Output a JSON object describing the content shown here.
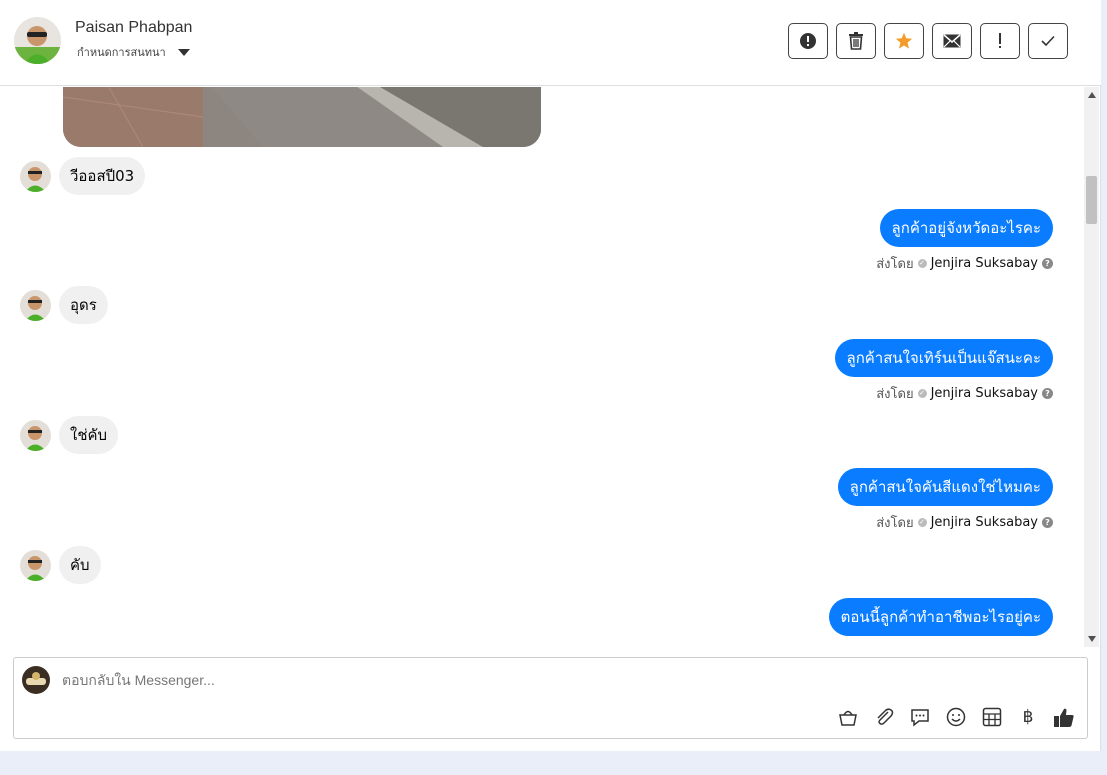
{
  "header": {
    "contact_name": "Paisan Phabpan",
    "conversation_label": "กำหนดการสนทนา"
  },
  "actions": [
    {
      "name": "alert-circle-button",
      "icon": "alert-circle-icon"
    },
    {
      "name": "delete-button",
      "icon": "trash-icon"
    },
    {
      "name": "star-button",
      "icon": "star-icon"
    },
    {
      "name": "email-button",
      "icon": "envelope-icon"
    },
    {
      "name": "important-button",
      "icon": "exclamation-icon"
    },
    {
      "name": "done-button",
      "icon": "check-icon"
    }
  ],
  "messages": [
    {
      "dir": "in",
      "text": "วีออสปี03"
    },
    {
      "dir": "out",
      "text": "ลูกค้าอยู่จังหวัดอะไรคะ",
      "sent_by_label": "ส่งโดย",
      "agent": "Jenjira Suksabay"
    },
    {
      "dir": "in",
      "text": "อุดร"
    },
    {
      "dir": "out",
      "text": "ลูกค้าสนใจเทิร์นเป็นแจ๊สนะคะ",
      "sent_by_label": "ส่งโดย",
      "agent": "Jenjira Suksabay"
    },
    {
      "dir": "in",
      "text": "ใช่คับ"
    },
    {
      "dir": "out",
      "text": "ลูกค้าสนใจคันสีแดงใช่ไหมคะ",
      "sent_by_label": "ส่งโดย",
      "agent": "Jenjira Suksabay"
    },
    {
      "dir": "in",
      "text": "คับ"
    },
    {
      "dir": "out",
      "text": "ตอนนี้ลูกค้าทำอาชีพอะไรอยู่คะ"
    }
  ],
  "composer": {
    "placeholder": "ตอบกลับใน Messenger..."
  },
  "composer_tools": [
    "basket-icon",
    "paperclip-icon",
    "chat-bubble-icon",
    "smiley-icon",
    "table-icon",
    "baht-icon",
    "thumbs-up-icon"
  ],
  "colors": {
    "outgoing_bubble": "#0a7cff",
    "incoming_bubble": "#f0f0f0",
    "star": "#f39c2b"
  }
}
